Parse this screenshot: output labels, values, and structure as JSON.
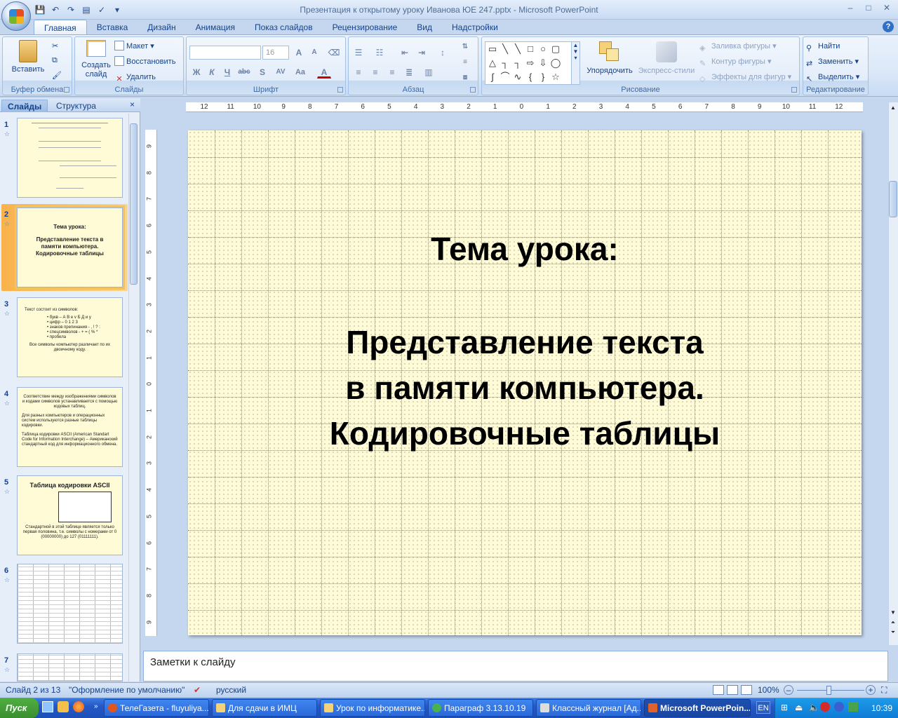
{
  "window": {
    "title": "Презентация к открытому уроку Иванова ЮЕ 247.pptx - Microsoft PowerPoint",
    "controls": [
      "–",
      "□",
      "✕"
    ]
  },
  "ribbon_tabs": [
    "Главная",
    "Вставка",
    "Дизайн",
    "Анимация",
    "Показ слайдов",
    "Рецензирование",
    "Вид",
    "Надстройки"
  ],
  "ribbon": {
    "clipboard": {
      "label": "Буфер обмена",
      "paste": "Вставить"
    },
    "slides": {
      "label": "Слайды",
      "new_slide": "Создать слайд",
      "layout": "Макет",
      "reset": "Восстановить",
      "delete": "Удалить"
    },
    "font": {
      "label": "Шрифт",
      "size": "16"
    },
    "paragraph": {
      "label": "Абзац"
    },
    "drawing": {
      "label": "Рисование",
      "arrange": "Упорядочить",
      "quick_styles": "Экспресс-стили",
      "shape_fill": "Заливка фигуры",
      "shape_outline": "Контур фигуры",
      "shape_effects": "Эффекты для фигур"
    },
    "editing": {
      "label": "Редактирование",
      "find": "Найти",
      "replace": "Заменить",
      "select": "Выделить"
    }
  },
  "pane": {
    "tabs": [
      "Слайды",
      "Структура"
    ],
    "close": "×"
  },
  "thumbnails": {
    "s2_title": "Тема урока:",
    "s2_body": "Представление текста в памяти компьютера. Кодировочные таблицы",
    "s3_lines": [
      "Текст состоит из символов:",
      "• букв – А В е v Б Д и у",
      "• цифр – 0 1 2 3",
      "• знаков препинания - , ! ? :",
      "• спецсимволов - + = ( % *",
      "• пробела",
      "Все символы компьютер различает по их двоичному коду."
    ],
    "s4_lines": [
      "Соответствие между изображениями символов и кодами символов устанавливается с помощью кодовых таблиц.",
      "Для разных компьютеров и операционных систем используются разные таблицы кодировки.",
      "Таблица кодировки ASCII (American Standart Code for Information Interchange) – Американский стандартный код для информационного обмена."
    ],
    "s5_title": "Таблица кодировки ASCII",
    "s5_note": "Стандартной в этой таблице является только первая половина, т.е. символы с номерами от 0 (00000000) до 127 (01111111)."
  },
  "slide": {
    "title": "Тема урока:",
    "body_lines": [
      "Представление текста",
      "в памяти компьютера.",
      "Кодировочные таблицы"
    ]
  },
  "notes_placeholder": "Заметки к слайду",
  "status": {
    "slide": "Слайд 2 из 13",
    "theme": "\"Оформление по умолчанию\"",
    "language": "русский",
    "zoom": "100%"
  },
  "taskbar": {
    "start": "Пуск",
    "tasks": [
      "ТелеГазета - fluyuliya...",
      "Для сдачи в ИМЦ",
      "Урок по информатике...",
      "Параграф 3.13.10.19",
      "Классный журнал [Ад...",
      "Microsoft PowerPoin..."
    ],
    "lang": "EN",
    "clock": "10:39"
  },
  "rulers": {
    "h": [
      "12",
      "11",
      "10",
      "9",
      "8",
      "7",
      "6",
      "5",
      "4",
      "3",
      "2",
      "1",
      "0",
      "1",
      "2",
      "3",
      "4",
      "5",
      "6",
      "7",
      "8",
      "9",
      "10",
      "11",
      "12"
    ],
    "v": [
      "9",
      "8",
      "7",
      "6",
      "5",
      "4",
      "3",
      "2",
      "1",
      "0",
      "1",
      "2",
      "3",
      "4",
      "5",
      "6",
      "7",
      "8",
      "9"
    ]
  }
}
